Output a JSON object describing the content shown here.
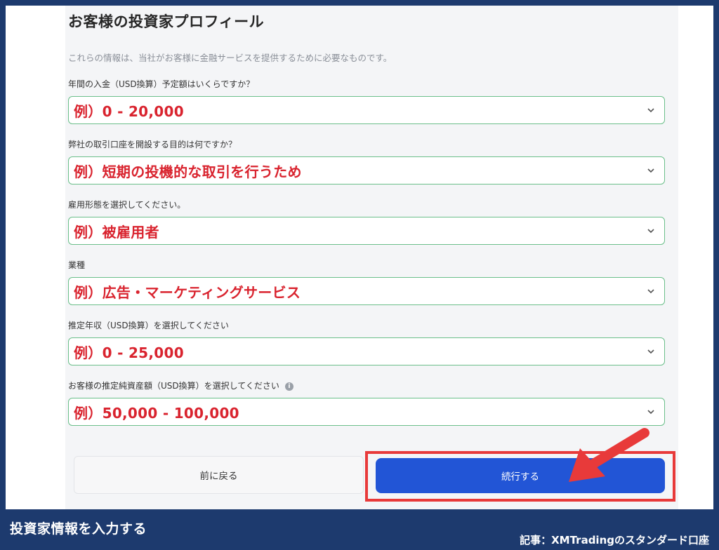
{
  "form": {
    "title": "お客様の投資家プロフィール",
    "subtitle": "これらの情報は、当社がお客様に金融サービスを提供するために必要なものです。",
    "fields": [
      {
        "label": "年間の入金（USD換算）予定額はいくらですか？",
        "value": "例）0 - 20,000"
      },
      {
        "label": "弊社の取引口座を開設する目的は何ですか？",
        "value": "例）短期の投機的な取引を行うため"
      },
      {
        "label": "雇用形態を選択してください。",
        "value": "例）被雇用者"
      },
      {
        "label": "業種",
        "value": "例）広告・マーケティングサービス"
      },
      {
        "label": "推定年収（USD換算）を選択してください",
        "value": "例）0 - 25,000"
      },
      {
        "label": "お客様の推定純資産額（USD換算）を選択してください",
        "value": "例）50,000 - 100,000"
      }
    ],
    "info_icon_glyph": "i"
  },
  "buttons": {
    "back": "前に戻る",
    "continue": "続行する"
  },
  "footer": {
    "caption": "投資家情報を入力する",
    "article": "記事：XMTradingのスタンダード口座"
  },
  "colors": {
    "background_navy": "#1d3a6e",
    "select_border": "#6bbf8a",
    "example_value_red": "#d9232e",
    "continue_blue": "#2255d6",
    "highlight_red": "#e83a3a"
  }
}
